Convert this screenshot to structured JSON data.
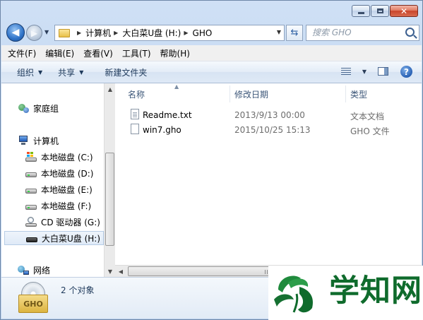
{
  "window": {
    "caption_buttons": [
      "minimize",
      "maximize",
      "close"
    ]
  },
  "address_bar": {
    "crumbs": [
      "计算机",
      "大白菜U盘 (H:)",
      "GHO"
    ]
  },
  "search": {
    "placeholder": "搜索 GHO"
  },
  "menu": [
    "文件(F)",
    "编辑(E)",
    "查看(V)",
    "工具(T)",
    "帮助(H)"
  ],
  "toolbar": {
    "organize": "组织",
    "share": "共享",
    "new_folder": "新建文件夹"
  },
  "nav_pane": {
    "homegroup": "家庭组",
    "computer": "计算机",
    "drives": [
      {
        "label": "本地磁盘 (C:)",
        "icon": "system-drive-icon"
      },
      {
        "label": "本地磁盘 (D:)",
        "icon": "hard-drive-icon"
      },
      {
        "label": "本地磁盘 (E:)",
        "icon": "hard-drive-icon"
      },
      {
        "label": "本地磁盘 (F:)",
        "icon": "hard-drive-icon"
      },
      {
        "label": "CD 驱动器 (G:)",
        "icon": "cd-drive-icon"
      },
      {
        "label": "大白菜U盘 (H:)",
        "icon": "usb-drive-icon",
        "selected": true
      }
    ],
    "network": "网络"
  },
  "columns": {
    "name": "名称",
    "date": "修改日期",
    "type": "类型"
  },
  "files": [
    {
      "name": "Readme.txt",
      "date": "2013/9/13 00:00",
      "type": "文本文档",
      "icon": "text-file-icon"
    },
    {
      "name": "win7.gho",
      "date": "2015/10/25 15:13",
      "type": "GHO 文件",
      "icon": "generic-file-icon"
    }
  ],
  "details": {
    "count": "2 个对象",
    "icon_label": "GHO"
  },
  "watermark": {
    "text": "学知网"
  },
  "colors": {
    "accent": "#1e395b",
    "watermark_green": "#0f6b2c"
  }
}
